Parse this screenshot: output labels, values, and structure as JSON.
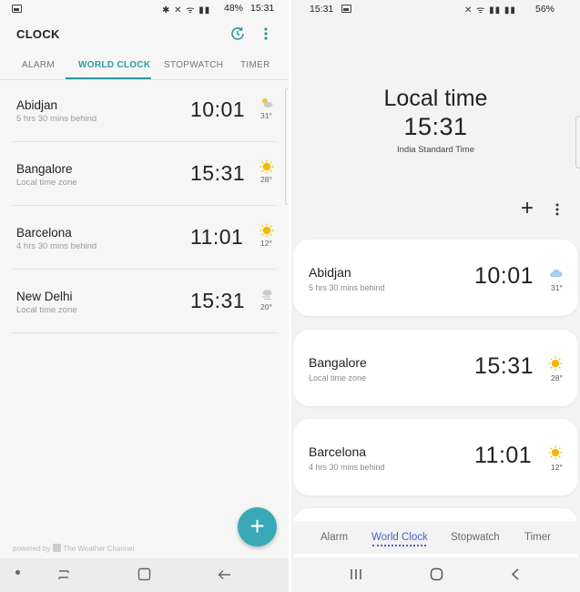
{
  "left": {
    "status": {
      "system_icons": "✱ ✕ ᯤ ▮▮",
      "battery": "48%",
      "time": "15:31"
    },
    "app_title": "CLOCK",
    "tabs": [
      {
        "label": "ALARM",
        "active": false
      },
      {
        "label": "WORLD CLOCK",
        "active": true
      },
      {
        "label": "STOPWATCH",
        "active": false
      },
      {
        "label": "TIMER",
        "active": false
      }
    ],
    "cities": [
      {
        "name": "Abidjan",
        "diff": "5 hrs 30 mins behind",
        "time": "10:01",
        "weather_icon": "cloud-sun-icon",
        "temp": "31°"
      },
      {
        "name": "Bangalore",
        "diff": "Local time zone",
        "time": "15:31",
        "weather_icon": "sun-icon",
        "temp": "28°"
      },
      {
        "name": "Barcelona",
        "diff": "4 hrs 30 mins behind",
        "time": "11:01",
        "weather_icon": "sun-icon",
        "temp": "12°"
      },
      {
        "name": "New Delhi",
        "diff": "Local time zone",
        "time": "15:31",
        "weather_icon": "haze-icon",
        "temp": "20°"
      }
    ],
    "fab_label": "+",
    "powered_by": "powered by",
    "weather_brand": "The Weather Channel"
  },
  "right": {
    "status": {
      "time": "15:31",
      "system_icons": "✕ ᯤ ▮▮ ▮▮",
      "battery": "56%"
    },
    "hero": {
      "title": "Local time",
      "time": "15:31",
      "zone": "India Standard Time"
    },
    "add_label": "+",
    "cities": [
      {
        "name": "Abidjan",
        "diff": "5 hrs 30 mins behind",
        "time": "10:01",
        "weather_icon": "cloud-icon",
        "temp": "31°"
      },
      {
        "name": "Bangalore",
        "diff": "Local time zone",
        "time": "15:31",
        "weather_icon": "sun-icon",
        "temp": "28°"
      },
      {
        "name": "Barcelona",
        "diff": "4 hrs 30 mins behind",
        "time": "11:01",
        "weather_icon": "sun-icon",
        "temp": "12°"
      }
    ],
    "tabs": [
      {
        "label": "Alarm",
        "active": false
      },
      {
        "label": "World Clock",
        "active": true
      },
      {
        "label": "Stopwatch",
        "active": false
      },
      {
        "label": "Timer",
        "active": false
      }
    ]
  },
  "colors": {
    "accent_left": "#2e98a4",
    "fab": "#3aa9b6",
    "accent_right": "#4c5fc6",
    "sun": "#f5b800"
  }
}
